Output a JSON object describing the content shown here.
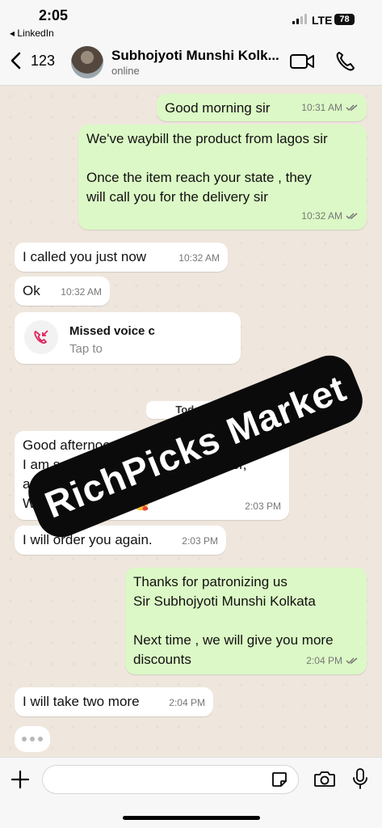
{
  "status_bar": {
    "time": "2:05",
    "back_app": "◂ LinkedIn",
    "network": "LTE",
    "battery": "78"
  },
  "header": {
    "back_count": "123",
    "contact_name": "Subhojyoti Munshi Kolk...",
    "contact_status": "online"
  },
  "messages": [
    {
      "direction": "out",
      "text": "Good morning sir",
      "time": "10:31 AM",
      "read": true
    },
    {
      "direction": "out",
      "text": "We've waybill the product from lagos sir\n\nOnce the item reach your state , they\nwill call you for the delivery sir",
      "time": "10:32 AM",
      "read": true
    },
    {
      "direction": "in",
      "text": "I called you just now",
      "time": "10:32 AM"
    },
    {
      "direction": "in",
      "text": "Ok",
      "time": "10:32 AM"
    },
    {
      "direction": "in",
      "text": "Good afternoon dear.\nI am so happy to receive the  diffuser,\nand it's a fantastic item .\nWorking perfectly 🥰",
      "time": "2:03 PM"
    },
    {
      "direction": "in",
      "text": "I will order you again.",
      "time": "2:03 PM"
    },
    {
      "direction": "out",
      "text": "Thanks for patronizing us\nSir Subhojyoti Munshi Kolkata\n\nNext time , we will give you more\ndiscounts",
      "time": "2:04 PM",
      "read": true
    },
    {
      "direction": "in",
      "text": "I will take two more",
      "time": "2:04 PM"
    }
  ],
  "missed_call": {
    "title": "Missed voice c",
    "subtitle": "Tap to"
  },
  "date_divider": "Today",
  "watermark": "RichPicks Market",
  "colors": {
    "outgoing_bubble": "#dcf8c6",
    "incoming_bubble": "#ffffff",
    "chat_background": "#efe7dd",
    "missed_call_red": "#e0245e",
    "read_ticks": "#777777"
  },
  "icons": {
    "back": "chevron-left-icon",
    "video": "video-camera-icon",
    "call": "phone-icon",
    "missed_call": "missed-call-icon",
    "plus": "plus-icon",
    "sticker": "sticker-icon",
    "camera": "camera-icon",
    "mic": "microphone-icon"
  }
}
